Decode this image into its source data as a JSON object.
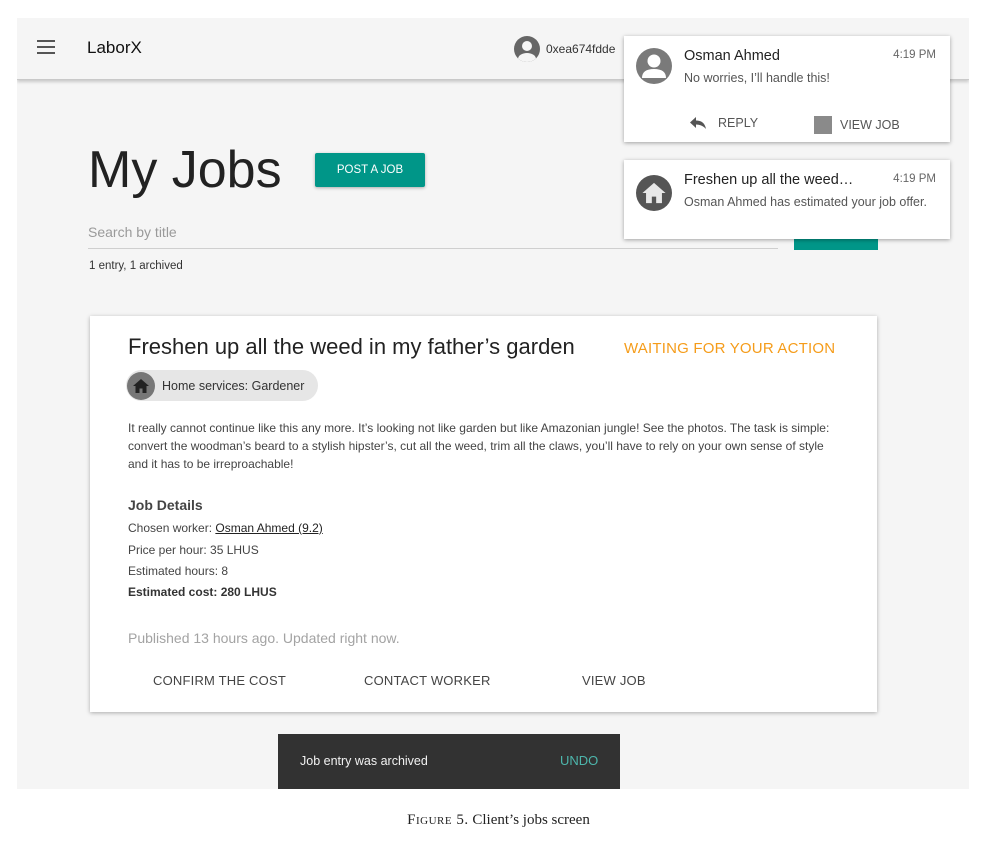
{
  "app": {
    "title": "LaborX"
  },
  "header": {
    "account_address": "0xea674fdde"
  },
  "page": {
    "title": "My Jobs",
    "post_job_label": "POST A JOB",
    "search_placeholder": "Search by title",
    "counts": "1 entry, 1 archived"
  },
  "job": {
    "title": "Freshen up all the weed in my father’s garden",
    "status": "WAITING FOR YOUR ACTION",
    "category": "Home services: Gardener",
    "description": "It really cannot continue like this any more. It’s looking not like garden but like Amazonian jungle! See the photos. The task is simple: convert the woodman’s beard to a stylish hipster’s, cut all the weed, trim all the claws, you’ll have to rely on your own sense of style and it has to be irreproachable!",
    "details_heading": "Job Details",
    "chosen_worker_label": "Chosen worker: ",
    "chosen_worker": "Osman Ahmed (9.2)",
    "price_per_hour": "Price per hour: 35 LHUS",
    "estimated_hours": "Estimated hours: 8",
    "estimated_cost": "Estimated cost: 280 LHUS",
    "published": "Published 13 hours ago. Updated right now.",
    "actions": {
      "confirm": "CONFIRM THE COST",
      "contact": "CONTACT WORKER",
      "view": "VIEW JOB"
    }
  },
  "snackbar": {
    "message": "Job entry was archived",
    "action": "UNDO"
  },
  "notifications": [
    {
      "sender": "Osman Ahmed",
      "time": "4:19 PM",
      "text": "No worries, I’ll handle this!",
      "reply_label": "REPLY",
      "view_label": "VIEW JOB"
    },
    {
      "sender": "Freshen up all the weed…",
      "time": "4:19 PM",
      "text": "Osman Ahmed has estimated your job offer."
    }
  ],
  "caption": {
    "label": "Figure 5.",
    "text": "Client’s jobs screen"
  },
  "colors": {
    "accent": "#009688",
    "status": "#f59c1a",
    "snackbar": "#323232",
    "undo": "#4db6ac"
  }
}
